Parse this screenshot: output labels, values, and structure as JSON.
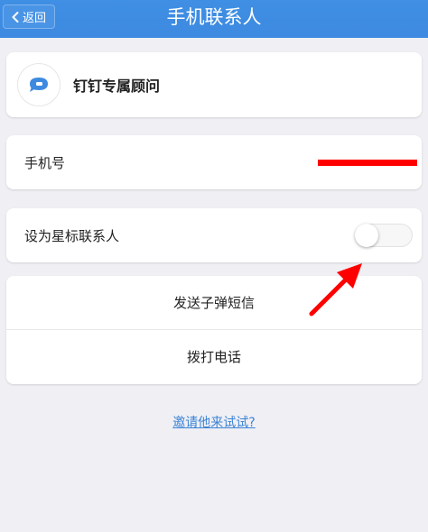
{
  "header": {
    "back_label": "返回",
    "title": "手机联系人"
  },
  "profile": {
    "name": "钉钉专属顾问",
    "avatar_icon": "chat-bubble-icon",
    "avatar_color": "#3d8ae0"
  },
  "phone": {
    "label": "手机号",
    "value_redacted": true,
    "redaction_color": "#ff0000"
  },
  "star_contact": {
    "label": "设为星标联系人",
    "enabled": false
  },
  "actions": {
    "sms_label": "发送子弹短信",
    "call_label": "拨打电话"
  },
  "invite": {
    "link_text": "邀请他来试试?"
  },
  "theme": {
    "header_color": "#3d8ae0",
    "background": "#efeff4",
    "link_color": "#3d84d6",
    "annotation_color": "#ff0000"
  }
}
